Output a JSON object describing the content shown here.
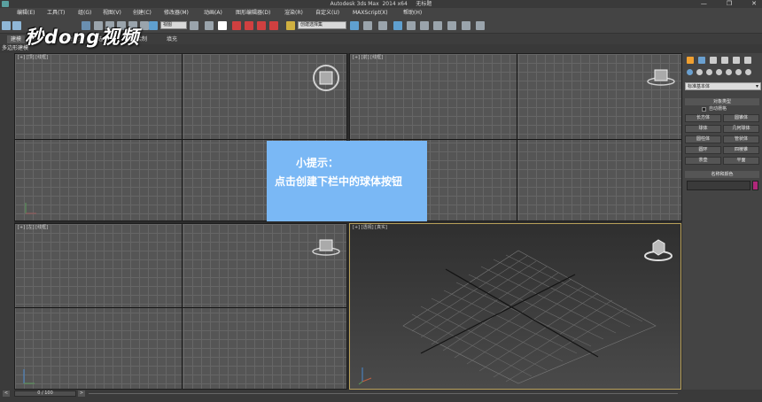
{
  "window": {
    "title": "Autodesk 3ds Max  2014 x64     无标题",
    "minimize": "—",
    "restore": "❐",
    "close": "✕"
  },
  "menu": [
    "编辑(E)",
    "工具(T)",
    "组(G)",
    "视图(V)",
    "创建(C)",
    "修改器(M)",
    "动画(A)",
    "图形编辑器(D)",
    "渲染(R)",
    "自定义(U)",
    "MAXScript(X)",
    "帮助(H)"
  ],
  "toolbar": {
    "selection_filter": "全部",
    "view_ref": "视图",
    "named_selection": "创建选择集"
  },
  "ribbon": {
    "tabs": [
      "建模",
      "自由形式",
      "选择",
      "对象绘制",
      "填充"
    ],
    "sub_label": "多边形建模"
  },
  "viewports": {
    "top": "[+] [顶] [线框]",
    "front": "[+] [前] [线框]",
    "left": "[+] [左] [线框]",
    "perspective": "[+] [透视] [真实]"
  },
  "command_panel": {
    "dropdown": "标准基本体",
    "object_type_header": "对象类型",
    "autogrid": "自动栅格",
    "buttons": [
      "长方体",
      "圆锥体",
      "球体",
      "几何球体",
      "圆柱体",
      "管状体",
      "圆环",
      "四棱锥",
      "茶壶",
      "平面"
    ],
    "name_color_header": "名称和颜色",
    "swatch_color": "#b0287a"
  },
  "timeline": {
    "frame_counter": "0 / 100",
    "prev": "<",
    "next": ">"
  },
  "tip": {
    "title": "小提示：",
    "text": "点击创建下栏中的球体按钮",
    "bg": "#7ab8f5"
  },
  "watermark": "秒dong视频"
}
